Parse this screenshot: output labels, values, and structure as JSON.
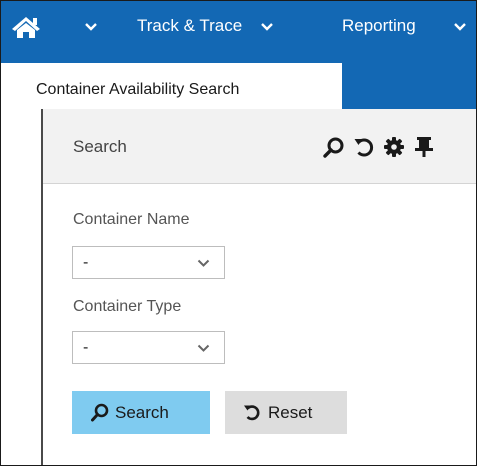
{
  "navbar": {
    "color": "#1368b4",
    "home_icon": "home-icon",
    "items": [
      {
        "label": "Track & Trace"
      },
      {
        "label": "Reporting"
      }
    ]
  },
  "tabs": [
    {
      "label": "Container Availability Search",
      "active": true
    }
  ],
  "panel": {
    "title": "Search",
    "icons": [
      "search-icon",
      "reset-icon",
      "gear-icon",
      "pin-icon"
    ]
  },
  "form": {
    "fields": [
      {
        "label": "Container Name",
        "value": "-"
      },
      {
        "label": "Container Type",
        "value": "-"
      }
    ]
  },
  "buttons": {
    "search_label": "Search",
    "search_color": "#7fcbf0",
    "reset_label": "Reset",
    "reset_color": "#dddddd"
  }
}
